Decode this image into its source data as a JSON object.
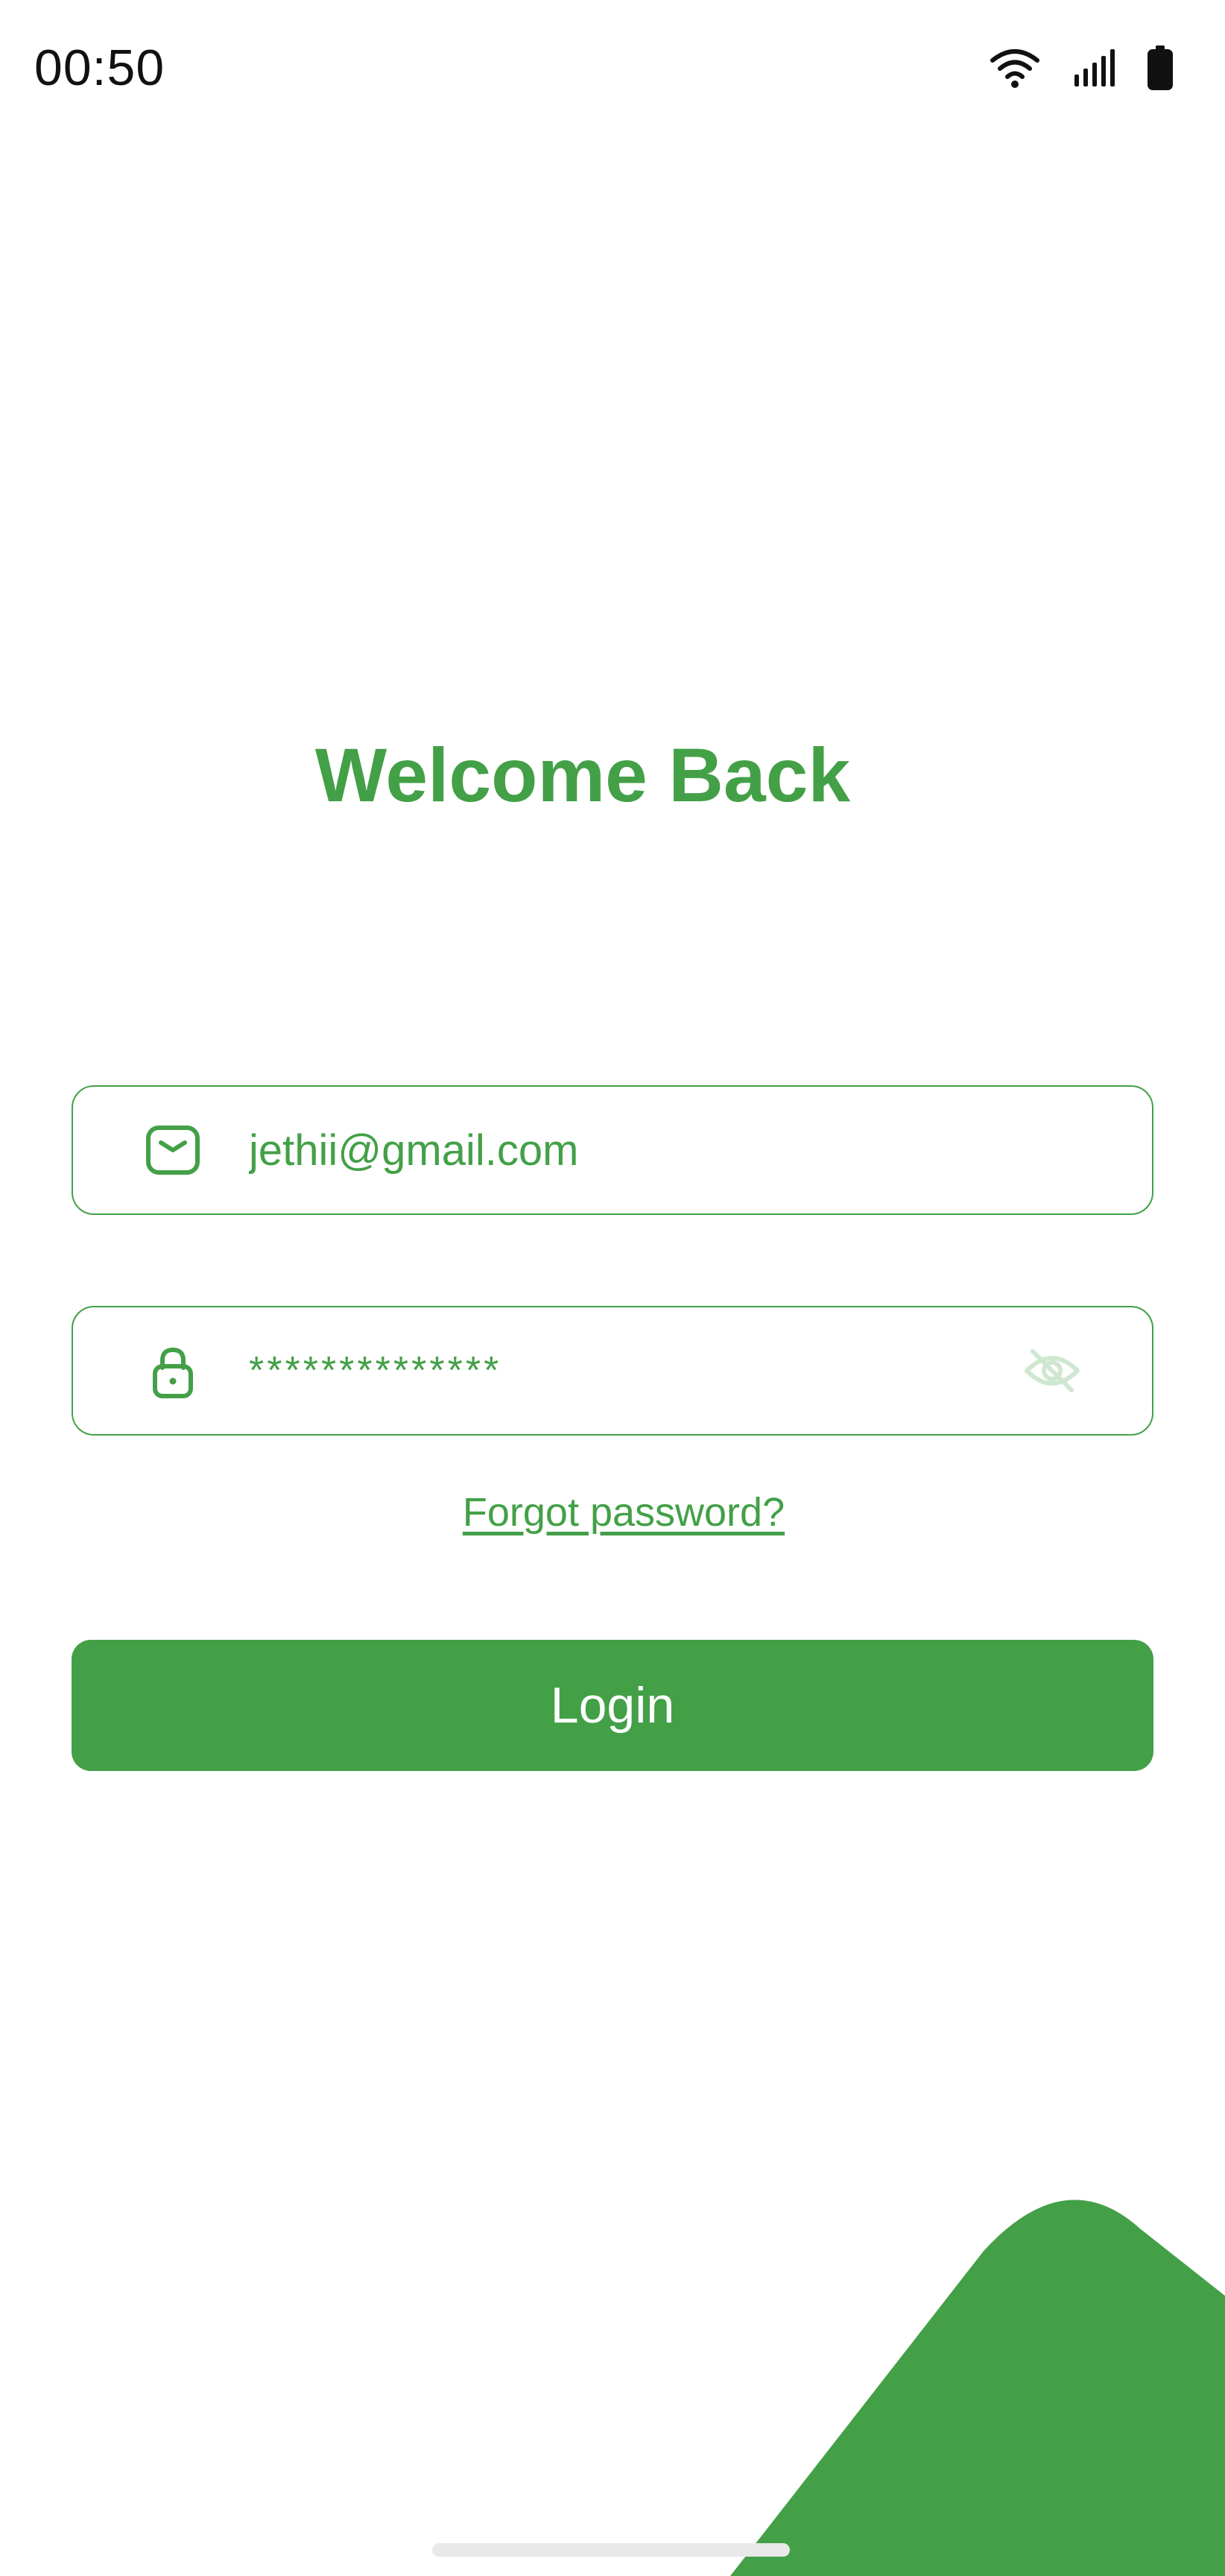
{
  "status_bar": {
    "time": "00:50",
    "icons": [
      "wifi-icon",
      "signal-icon",
      "battery-icon"
    ]
  },
  "title": "Welcome Back",
  "email_field": {
    "value": "jethii@gmail.com",
    "icon": "mail-icon"
  },
  "password_field": {
    "masked_value": "**************",
    "icon": "lock-icon",
    "toggle_icon": "eye-off-icon"
  },
  "forgot_password_label": "Forgot password?",
  "login_label": "Login",
  "colors": {
    "primary": "#43a047",
    "background": "#ffffff",
    "text_dark": "#111111"
  }
}
